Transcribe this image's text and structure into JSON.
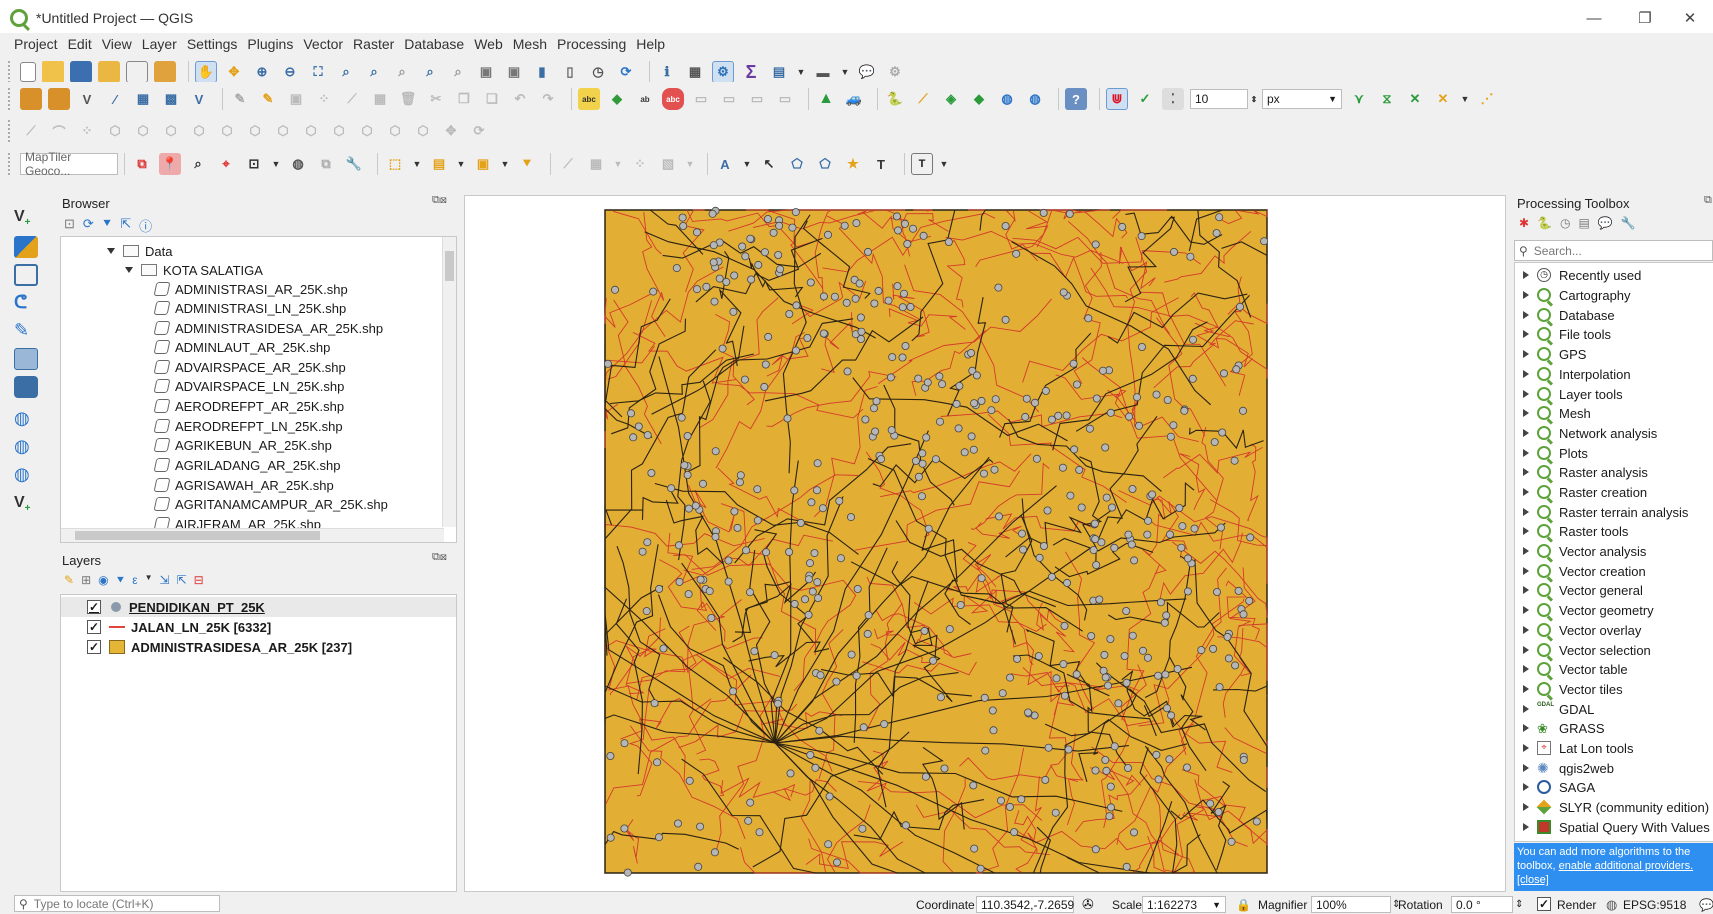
{
  "window": {
    "title": "*Untitled Project — QGIS",
    "controls": [
      "—",
      "❐",
      "✕"
    ]
  },
  "menu": [
    "Project",
    "Edit",
    "View",
    "Layer",
    "Settings",
    "Plugins",
    "Vector",
    "Raster",
    "Database",
    "Web",
    "Mesh",
    "Processing",
    "Help"
  ],
  "toolbar": {
    "snap_tolerance": "10",
    "snap_unit": "px",
    "geocoder_placeholder": "MapTiler Geoco..."
  },
  "browser": {
    "title": "Browser",
    "folder": "Data",
    "subfolder": "KOTA SALATIGA",
    "files": [
      "ADMINISTRASI_AR_25K.shp",
      "ADMINISTRASI_LN_25K.shp",
      "ADMINISTRASIDESA_AR_25K.shp",
      "ADMINLAUT_AR_25K.shp",
      "ADVAIRSPACE_AR_25K.shp",
      "ADVAIRSPACE_LN_25K.shp",
      "AERODREFPT_AR_25K.shp",
      "AERODREFPT_LN_25K.shp",
      "AGRIKEBUN_AR_25K.shp",
      "AGRILADANG_AR_25K.shp",
      "AGRISAWAH_AR_25K.shp",
      "AGRITANAMCAMPUR_AR_25K.shp",
      "AIRJERAM_AR_25K.shp"
    ]
  },
  "layers": {
    "title": "Layers",
    "items": [
      {
        "name": "PENDIDIKAN_PT_25K",
        "checked": "✓",
        "symbol": "point",
        "color": "#b0b0b0"
      },
      {
        "name": "JALAN_LN_25K [6332]",
        "checked": "✓",
        "symbol": "line",
        "color": "#e0463c"
      },
      {
        "name": "ADMINISTRASIDESA_AR_25K [237]",
        "checked": "✓",
        "symbol": "polygon",
        "color": "#e5b636"
      }
    ]
  },
  "map": {
    "fill_color": "#e2ae34",
    "boundary_color": "#2b2212",
    "road_color": "#d43a2a",
    "point_color": "#b6b6b6"
  },
  "processing": {
    "title": "Processing Toolbox",
    "search_placeholder": "Search...",
    "items": [
      {
        "label": "Recently used",
        "icon": "clock-icon"
      },
      {
        "label": "Cartography",
        "icon": "qgis-icon"
      },
      {
        "label": "Database",
        "icon": "qgis-icon"
      },
      {
        "label": "File tools",
        "icon": "qgis-icon"
      },
      {
        "label": "GPS",
        "icon": "qgis-icon"
      },
      {
        "label": "Interpolation",
        "icon": "qgis-icon"
      },
      {
        "label": "Layer tools",
        "icon": "qgis-icon"
      },
      {
        "label": "Mesh",
        "icon": "qgis-icon"
      },
      {
        "label": "Network analysis",
        "icon": "qgis-icon"
      },
      {
        "label": "Plots",
        "icon": "qgis-icon"
      },
      {
        "label": "Raster analysis",
        "icon": "qgis-icon"
      },
      {
        "label": "Raster creation",
        "icon": "qgis-icon"
      },
      {
        "label": "Raster terrain analysis",
        "icon": "qgis-icon"
      },
      {
        "label": "Raster tools",
        "icon": "qgis-icon"
      },
      {
        "label": "Vector analysis",
        "icon": "qgis-icon"
      },
      {
        "label": "Vector creation",
        "icon": "qgis-icon"
      },
      {
        "label": "Vector general",
        "icon": "qgis-icon"
      },
      {
        "label": "Vector geometry",
        "icon": "qgis-icon"
      },
      {
        "label": "Vector overlay",
        "icon": "qgis-icon"
      },
      {
        "label": "Vector selection",
        "icon": "qgis-icon"
      },
      {
        "label": "Vector table",
        "icon": "qgis-icon"
      },
      {
        "label": "Vector tiles",
        "icon": "qgis-icon"
      },
      {
        "label": "GDAL",
        "icon": "gdal-icon"
      },
      {
        "label": "GRASS",
        "icon": "grass-icon"
      },
      {
        "label": "Lat Lon tools",
        "icon": "latlon-icon"
      },
      {
        "label": "qgis2web",
        "icon": "gear-icon"
      },
      {
        "label": "SAGA",
        "icon": "saga-icon"
      },
      {
        "label": "SLYR (community edition)",
        "icon": "slyr-icon"
      },
      {
        "label": "Spatial Query With Values",
        "icon": "spatial-query-icon"
      }
    ],
    "notice_text": "You can add more algorithms to the toolbox,",
    "notice_link": "enable additional providers.",
    "notice_close": "[close]"
  },
  "status": {
    "locate_placeholder": "Type to locate (Ctrl+K)",
    "coordinate_label": "Coordinate",
    "coordinate_value": "110.3542,-7.2659",
    "scale_label": "Scale",
    "scale_value": "1:162273",
    "magnifier_label": "Magnifier",
    "magnifier_value": "100%",
    "rotation_label": "Rotation",
    "rotation_value": "0.0 °",
    "render_label": "Render",
    "render_checked": "✓",
    "crs": "EPSG:9518"
  }
}
